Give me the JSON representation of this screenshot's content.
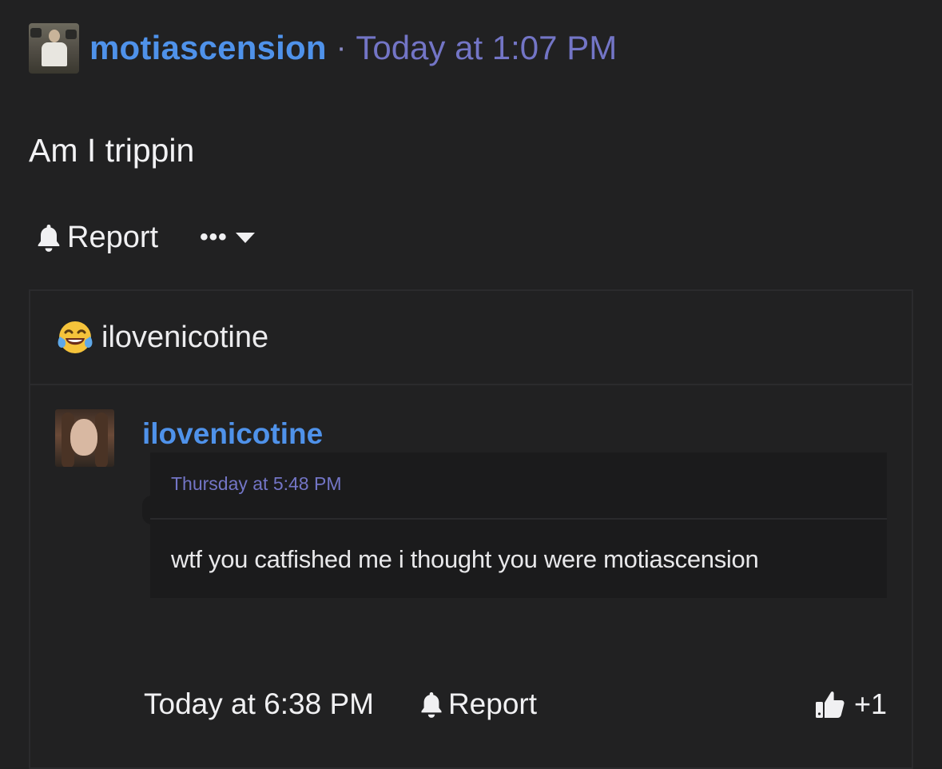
{
  "post": {
    "username": "motiascension",
    "separator": "·",
    "timestamp": "Today at 1:07 PM",
    "body": "Am I trippin",
    "actions": {
      "report_label": "Report",
      "more_label": "•••"
    }
  },
  "quote": {
    "emoji": "face-with-tears-of-joy",
    "title": "ilovenicotine",
    "author": "ilovenicotine",
    "message_time": "Thursday at 5:48 PM",
    "message_text": "wtf you catfished me i thought you were motiascension",
    "footer": {
      "timestamp": "Today at 6:38 PM",
      "report_label": "Report",
      "like_count": "+1"
    }
  },
  "colors": {
    "background": "#212122",
    "username_blue": "#4f92ea",
    "timestamp_purple": "#7375c6",
    "text": "#ececee"
  }
}
